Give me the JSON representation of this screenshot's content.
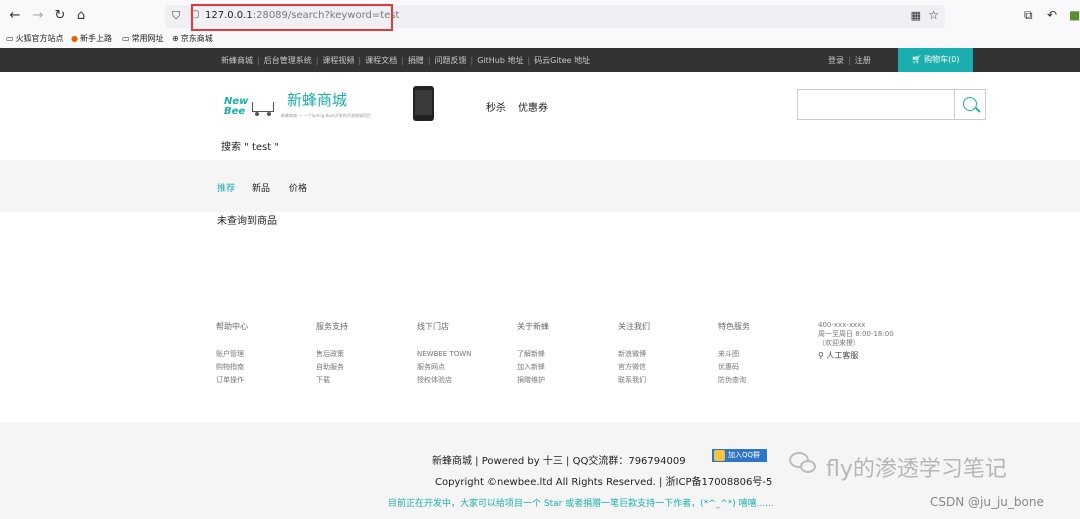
{
  "browser": {
    "url_host": "127.0.0.1",
    "url_rest": ":28089/search?keyword=test",
    "bookmarks": [
      "火狐官方站点",
      "新手上路",
      "常用网址",
      "京东商城"
    ]
  },
  "site_top": {
    "links": [
      "新蜂商城",
      "后台管理系统",
      "课程视频",
      "课程文档",
      "捐赠",
      "问题反馈",
      "GitHub 地址",
      "码云Gitee 地址"
    ],
    "login": "登录",
    "register": "注册",
    "cart": "购物车(0)"
  },
  "header": {
    "logo_line1": "New",
    "logo_line2": "Bee",
    "site_name": "新蜂商城",
    "slogan": "新蜂商城 — 一个Spring Boot开发的开源商城项目",
    "nav": [
      "秒杀",
      "优惠券"
    ],
    "search_label": "搜索 \" test \""
  },
  "sortbar": {
    "tabs": [
      "推荐",
      "新品",
      "价格"
    ],
    "active": 0
  },
  "empty_message": "未查询到商品",
  "footer": {
    "columns": [
      {
        "title": "帮助中心",
        "items": [
          "账户管理",
          "购物指南",
          "订单操作"
        ]
      },
      {
        "title": "服务支持",
        "items": [
          "售后政策",
          "自助服务",
          "下载"
        ]
      },
      {
        "title": "线下门店",
        "items": [
          "NEWBEE TOWN",
          "服务网点",
          "授权体验店"
        ]
      },
      {
        "title": "关于新蜂",
        "items": [
          "了解新蜂",
          "加入新蜂",
          "捐赠维护"
        ]
      },
      {
        "title": "关注我们",
        "items": [
          "新浪微博",
          "官方微信",
          "联系我们"
        ]
      },
      {
        "title": "特色服务",
        "items": [
          "来斗图",
          "优惠码",
          "防伪查询"
        ]
      }
    ],
    "contact": {
      "phone": "400-xxx-xxxx",
      "hours": "周一至周日 8:00-18:00",
      "welcome": "（欢迎来撩）",
      "service": "人工客服"
    }
  },
  "bottom": {
    "line1": "新蜂商城  |  Powered by 十三  |  QQ交流群：796794009",
    "qq_badge": "加入QQ群",
    "line2": "Copyright ©newbee.ltd All Rights Reserved.  |  浙ICP备17008806号-5",
    "line3": "目前正在开发中，大家可以给项目一个 Star 或者捐赠一笔巨款支持一下作者，(*^_^*) 嘻嘻......"
  },
  "watermarks": {
    "wechat_text": "fly的渗透学习笔记",
    "csdn": "CSDN @ju_ju_bone"
  },
  "colors": {
    "accent": "#1baeae",
    "topbar": "#333333",
    "highlight": "#e53935"
  }
}
